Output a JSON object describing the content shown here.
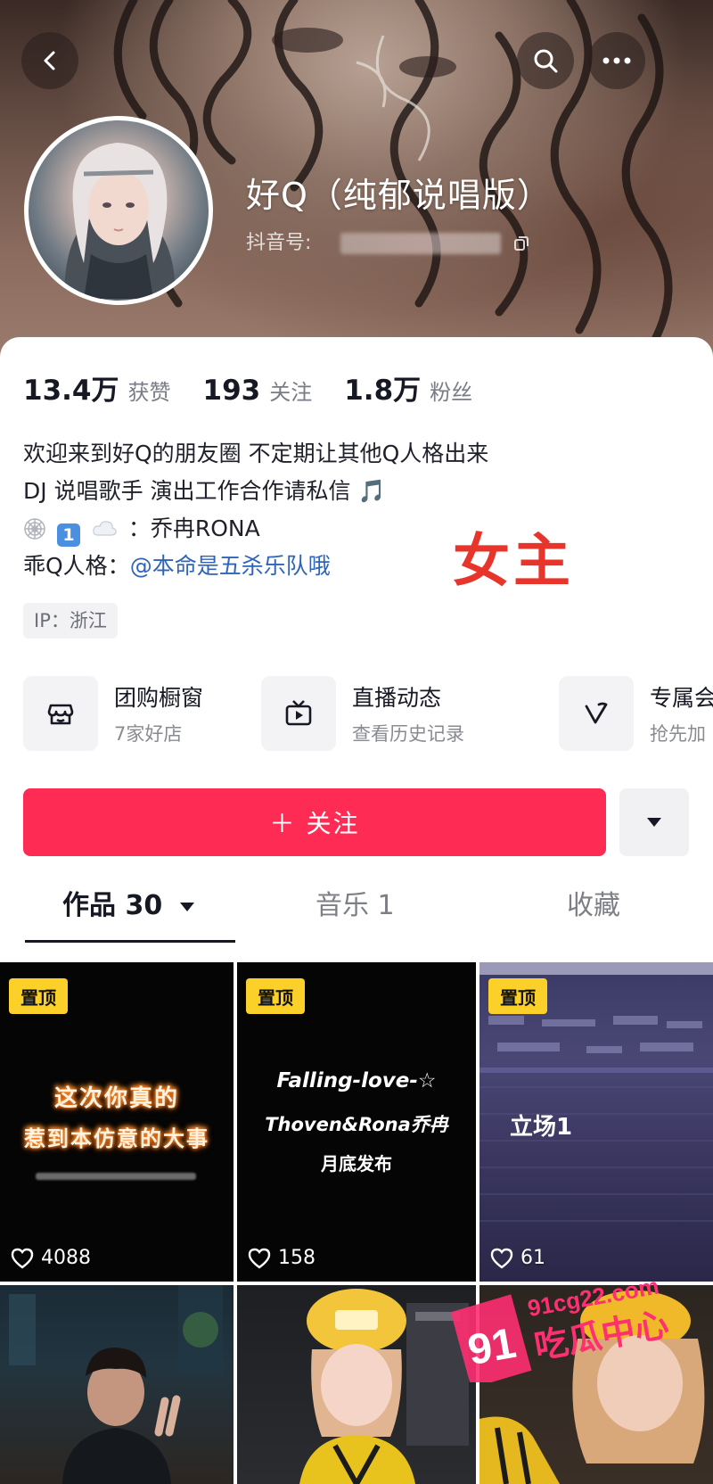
{
  "header": {
    "name": "好Q（纯郁说唱版）",
    "uid_label": "抖音号:"
  },
  "stats": [
    {
      "num": "13.4万",
      "label": "获赞"
    },
    {
      "num": "193",
      "label": "关注"
    },
    {
      "num": "1.8万",
      "label": "粉丝"
    }
  ],
  "bio": {
    "line1": "欢迎来到好Q的朋友圈 不定期让其他Q人格出来",
    "line2": " DJ 说唱歌手 演出工作合作请私信 🎵",
    "line3_text": "：乔冉RONA",
    "line3_badge": "1",
    "line4_prefix": "乖Q人格：",
    "line4_mention": "@本命是五杀乐队哦"
  },
  "ip_tag": "IP：浙江",
  "annotation": "女主",
  "services": [
    {
      "title": "团购橱窗",
      "sub": "7家好店",
      "icon": "store-icon"
    },
    {
      "title": "直播动态",
      "sub": "查看历史记录",
      "icon": "tv-icon"
    },
    {
      "title": "专属会",
      "sub": "抢先加",
      "icon": "v-icon"
    }
  ],
  "follow_label": "＋ 关注",
  "tabs": [
    {
      "label": "作品 30",
      "active": true
    },
    {
      "label": "音乐 1",
      "active": false
    },
    {
      "label": "收藏",
      "active": false
    }
  ],
  "grid": {
    "pin_label": "置顶",
    "tiles": [
      {
        "likes": "4088",
        "line1": "这次你真的",
        "line2": "惹到本仿意的大事"
      },
      {
        "likes": "158",
        "line1": "Falling-love-☆",
        "line2": "Thoven&Rona乔冉",
        "line3": "月底发布"
      },
      {
        "likes": "61",
        "line1": "立场1"
      }
    ]
  },
  "watermark": {
    "num": "91",
    "site": "91cg22.com",
    "name": "吃瓜中心"
  },
  "colors": {
    "accent": "#fe2c55",
    "pin": "#fbd029",
    "mention": "#2f64b8"
  }
}
